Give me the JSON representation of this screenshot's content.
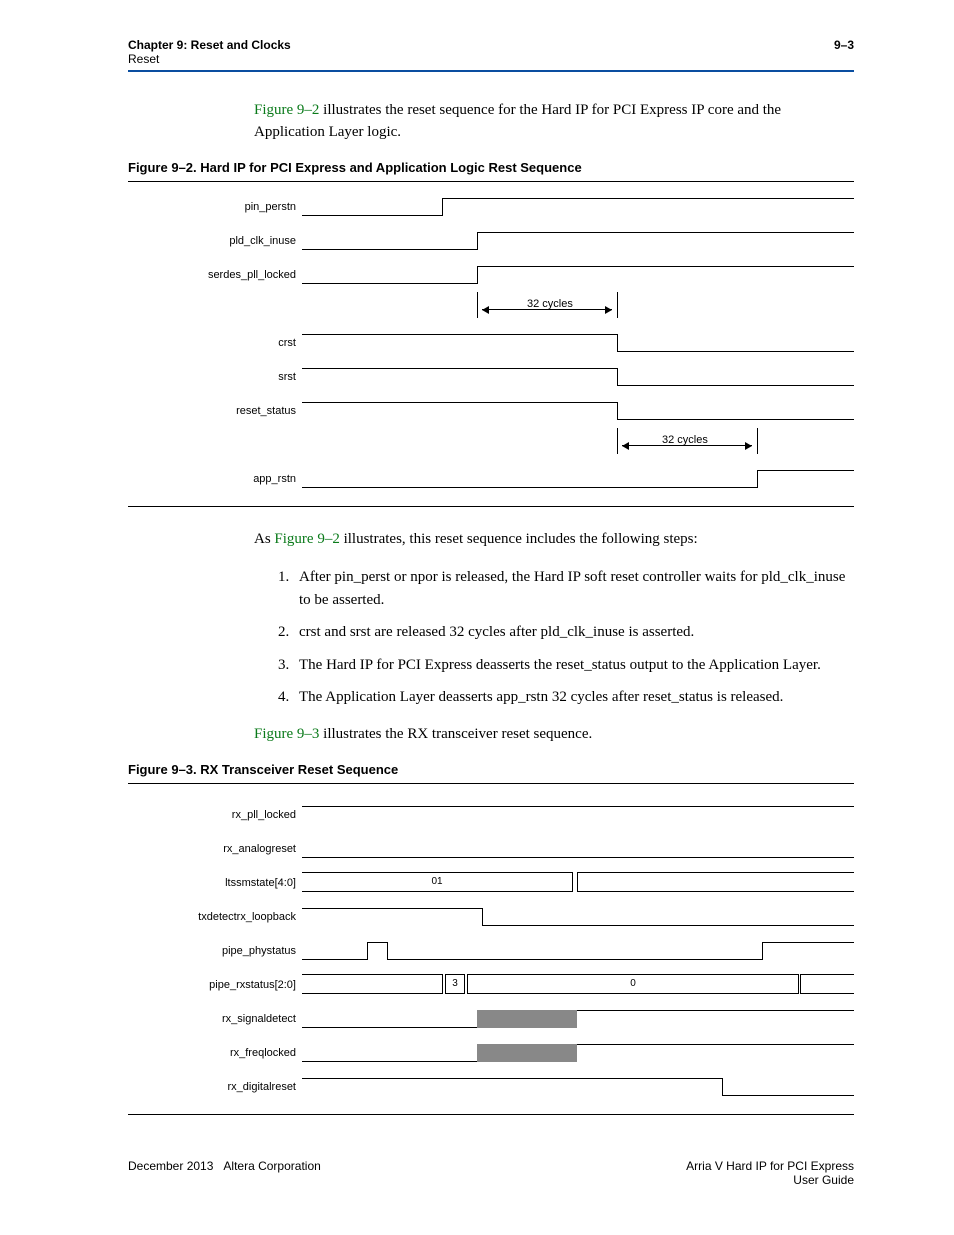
{
  "header": {
    "chapter": "Chapter 9: Reset and Clocks",
    "section": "Reset",
    "pagenum": "9–3"
  },
  "intro": {
    "figref": "Figure 9–2",
    "rest": " illustrates the reset sequence for the Hard IP for PCI Express IP core and the Application Layer logic."
  },
  "fig92": {
    "caption": "Figure 9–2.  Hard IP for PCI Express and Application Logic Rest Sequence",
    "signals": [
      "pin_perstn",
      "pld_clk_inuse",
      "serdes_pll_locked",
      "crst",
      "srst",
      "reset_status",
      "app_rstn"
    ],
    "anno1": "32 cycles",
    "anno2": "32  cycles"
  },
  "after92": {
    "lead_pre": "As ",
    "figref": "Figure 9–2",
    "lead_post": " illustrates, this reset sequence includes the following steps:"
  },
  "steps": [
    "After pin_perst or npor is released, the Hard IP soft reset controller waits for pld_clk_inuse to be asserted.",
    "crst and srst are released 32 cycles after pld_clk_inuse is asserted.",
    "The Hard IP for PCI Express deasserts the reset_status output to the Application Layer.",
    "The Application Layer deasserts app_rstn 32 cycles after reset_status is released."
  ],
  "post_steps": {
    "figref": "Figure 9–3",
    "rest": " illustrates the RX transceiver reset sequence."
  },
  "fig93": {
    "caption": "Figure 9–3.  RX Transceiver Reset Sequence",
    "signals": [
      "rx_pll_locked",
      "rx_analogreset",
      "ltssmstate[4:0]",
      "txdetectrx_loopback",
      "pipe_phystatus",
      "pipe_rxstatus[2:0]",
      "rx_signaldetect",
      "rx_freqlocked",
      "rx_digitalreset"
    ],
    "val01": "01",
    "val3": "3",
    "val0": "0"
  },
  "footer": {
    "leftdate": "December 2013",
    "leftcorp": "Altera Corporation",
    "right1": "Arria V Hard IP for PCI Express",
    "right2": "User Guide"
  },
  "chart_data": [
    {
      "type": "timing-diagram",
      "title": "Hard IP for PCI Express and Application Logic Rest Sequence",
      "signals": [
        {
          "name": "pin_perstn",
          "transition": "low→high at t0"
        },
        {
          "name": "pld_clk_inuse",
          "transition": "low→high at t1 (> t0)"
        },
        {
          "name": "serdes_pll_locked",
          "transition": "low→high at t1"
        },
        {
          "name": "crst",
          "transition": "high→low at t1+32 cycles"
        },
        {
          "name": "srst",
          "transition": "high→low at t1+32 cycles"
        },
        {
          "name": "reset_status",
          "transition": "high→low at t1+32 cycles"
        },
        {
          "name": "app_rstn",
          "transition": "low→high at (reset_status release)+32 cycles"
        }
      ],
      "annotations": [
        {
          "label": "32 cycles",
          "from": "pld_clk_inuse rise",
          "to": "crst/srst/reset_status fall"
        },
        {
          "label": "32 cycles",
          "from": "reset_status fall",
          "to": "app_rstn rise"
        }
      ]
    },
    {
      "type": "timing-diagram",
      "title": "RX Transceiver Reset Sequence",
      "signals": [
        {
          "name": "rx_pll_locked",
          "value": "high (constant)"
        },
        {
          "name": "rx_analogreset",
          "value": "low (constant)"
        },
        {
          "name": "ltssmstate[4:0]",
          "segments": [
            {
              "value": "01",
              "until": "t_mid"
            },
            {
              "value": "(next)",
              "from": "t_mid"
            }
          ]
        },
        {
          "name": "txdetectrx_loopback",
          "transition": "pulse high then low before t_mid"
        },
        {
          "name": "pipe_phystatus",
          "transition": "brief high pulse around t_mid, then high near end"
        },
        {
          "name": "pipe_rxstatus[2:0]",
          "segments": [
            {
              "value": "3",
              "approx": "narrow, before t_mid"
            },
            {
              "value": "0",
              "approx": "after t_mid"
            }
          ]
        },
        {
          "name": "rx_signaldetect",
          "transition": "unknown region until just after t_mid, then high"
        },
        {
          "name": "rx_freqlocked",
          "transition": "unknown region until just after t_mid, then high"
        },
        {
          "name": "rx_digitalreset",
          "transition": "high→low after rx_freqlocked asserts"
        }
      ]
    }
  ]
}
